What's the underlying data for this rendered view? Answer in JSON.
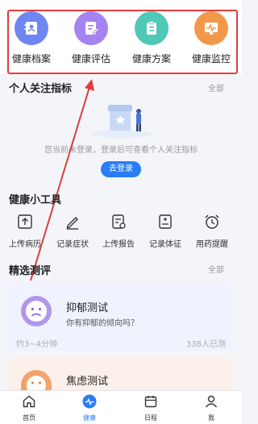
{
  "features": [
    {
      "label": "健康档案",
      "icon": "health-record-icon",
      "color": "#6d86f2"
    },
    {
      "label": "健康评估",
      "icon": "health-assessment-icon",
      "color": "#a583f0"
    },
    {
      "label": "健康方案",
      "icon": "health-plan-icon",
      "color": "#4fc7b9"
    },
    {
      "label": "健康监控",
      "icon": "health-monitor-icon",
      "color": "#f2984a"
    }
  ],
  "indicators": {
    "title": "个人关注指标",
    "more": "全部",
    "prompt": "您当前未登录，登录后可查看个人关注指标",
    "login_button": "去登录"
  },
  "tools": {
    "title": "健康小工具",
    "items": [
      {
        "label": "上传病历",
        "icon": "upload-icon"
      },
      {
        "label": "记录症状",
        "icon": "pen-icon"
      },
      {
        "label": "上传报告",
        "icon": "report-icon"
      },
      {
        "label": "记录体征",
        "icon": "vitals-icon"
      },
      {
        "label": "用药提醒",
        "icon": "alarm-clock-icon"
      }
    ]
  },
  "assessments": {
    "title": "精选测评",
    "more": "全部",
    "items": [
      {
        "title": "抑郁测试",
        "desc": "你有抑郁的倾向吗？",
        "duration": "约3~4分钟",
        "count": "338人已测"
      },
      {
        "title": "焦虑测试"
      }
    ]
  },
  "tabbar": [
    {
      "label": "首页",
      "icon": "home-icon",
      "active": false
    },
    {
      "label": "健康",
      "icon": "health-icon",
      "active": true
    },
    {
      "label": "日程",
      "icon": "calendar-icon",
      "active": false
    },
    {
      "label": "我",
      "icon": "user-icon",
      "active": false
    }
  ],
  "colors": {
    "accent": "#2a7df7",
    "highlight_border": "#e23c3c",
    "arrow": "#e23c3c"
  }
}
